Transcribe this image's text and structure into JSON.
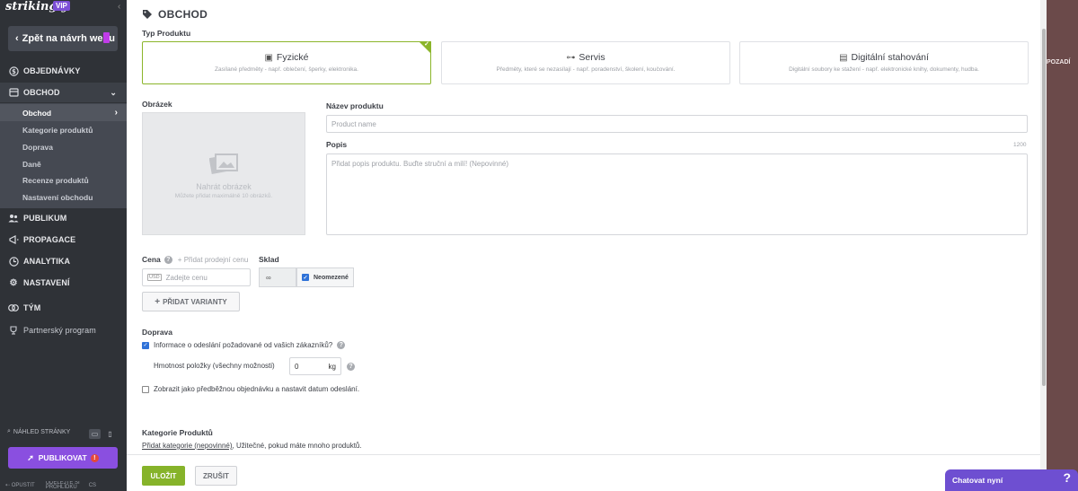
{
  "sidebar": {
    "logo": "strikingly",
    "vip": "VIP",
    "back_label": "Zpět na návrh webu",
    "nav": [
      {
        "label": "OBJEDNÁVKY",
        "icon": "dollar-icon"
      },
      {
        "label": "OBCHOD",
        "icon": "shop-icon"
      },
      {
        "label": "PUBLIKUM",
        "icon": "users-icon"
      },
      {
        "label": "PROPAGACE",
        "icon": "megaphone-icon"
      },
      {
        "label": "ANALYTIKA",
        "icon": "clock-icon"
      },
      {
        "label": "NASTAVENÍ",
        "icon": "gear-icon"
      },
      {
        "label": "TÝM",
        "icon": "team-icon"
      },
      {
        "label": "Partnerský program",
        "icon": "trophy-icon"
      }
    ],
    "sub": [
      "Obchod",
      "Kategorie produktů",
      "Doprava",
      "Daně",
      "Recenze produktů",
      "Nastavení obchodu"
    ],
    "preview_label": "NÁHLED STRÁNKY",
    "publish_label": "PUBLIKOVAT",
    "publish_badge": "!",
    "bottom": {
      "exit": "OPUSTIT",
      "rate": "UDĚLEJTE SI PROHLÍDKU",
      "lang": "CS"
    }
  },
  "header": {
    "title": "OBCHOD",
    "icon": "tag-icon"
  },
  "product_type": {
    "label": "Typ Produktu",
    "options": [
      {
        "title": "Fyzické",
        "desc": "Zasílané předměty - např. oblečení, šperky, elektronika.",
        "icon": "box-icon",
        "selected": true
      },
      {
        "title": "Servis",
        "desc": "Předměty, které se nezasílají - např. poradenství, školení, koučování.",
        "icon": "dumbbell-icon",
        "selected": false
      },
      {
        "title": "Digitální stahování",
        "desc": "Digitální soubory ke stažení - např. elektronické knihy, dokumenty, hudba.",
        "icon": "document-icon",
        "selected": false
      }
    ]
  },
  "image": {
    "label": "Obrázek",
    "upload": "Nahrát obrázek",
    "hint": "Můžete přidat maximálně 10 obrázků."
  },
  "name": {
    "label": "Název produktu",
    "placeholder": "Product name"
  },
  "description": {
    "label": "Popis",
    "counter": "1200",
    "placeholder": "Přidat popis produktu. Buďte struční a milí! (Nepovinné)"
  },
  "price": {
    "label": "Cena",
    "add_sale": "+ Přidat prodejní cenu",
    "currency": "USD",
    "placeholder": "Zadejte cenu"
  },
  "stock": {
    "label": "Sklad",
    "value": "∞",
    "unlimited": "Neomezené"
  },
  "add_variant": "PŘIDAT VARIANTY",
  "shipping": {
    "label": "Doprava",
    "collect_info": "Informace o odeslání požadované od vašich zákazníků?",
    "weight_label": "Hmotnost položky (všechny možnosti)",
    "weight_value": "0",
    "weight_unit": "kg",
    "preorder": "Zobrazit jako předběžnou objednávku a nastavit datum odeslání."
  },
  "category": {
    "label": "Kategorie Produktů",
    "link": "Přidat kategorie (nepovinné)",
    "rest": ", Užitečné, pokud máte mnoho produktů."
  },
  "footer": {
    "save": "ULOŽIT",
    "cancel": "ZRUŠIT"
  },
  "right_panel": {
    "label": "POZADÍ"
  },
  "chat": {
    "label": "Chatovat nyní",
    "help": "?"
  },
  "colors": {
    "accent_green": "#86b32a",
    "sidebar": "#2f3237",
    "publish": "#8a4fe0",
    "chat": "#6e4fd1"
  }
}
